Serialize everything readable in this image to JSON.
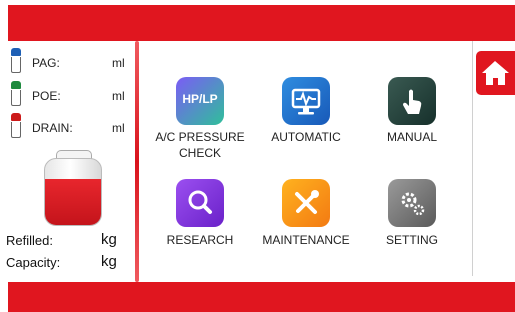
{
  "left_panel": {
    "fluids": [
      {
        "label": "PAG:",
        "unit": "ml",
        "color": "#1e5fb5"
      },
      {
        "label": "POE:",
        "unit": "ml",
        "color": "#1d8a3d"
      },
      {
        "label": "DRAIN:",
        "unit": "ml",
        "color": "#cc1a1a"
      }
    ],
    "refilled_label": "Refilled:",
    "refilled_unit": "kg",
    "capacity_label": "Capacity:",
    "capacity_unit": "kg"
  },
  "menu": {
    "items": [
      {
        "label": "A/C PRESSURE\nCHECK",
        "icon": "hp-lp-icon",
        "icon_text": "HP/LP"
      },
      {
        "label": "AUTOMATIC",
        "icon": "monitor-icon"
      },
      {
        "label": "MANUAL",
        "icon": "hand-pointer-icon"
      },
      {
        "label": "RESEARCH",
        "icon": "magnifier-icon"
      },
      {
        "label": "MAINTENANCE",
        "icon": "tools-icon"
      },
      {
        "label": "SETTING",
        "icon": "gears-icon"
      }
    ]
  },
  "home_button": {
    "icon": "home-icon"
  }
}
